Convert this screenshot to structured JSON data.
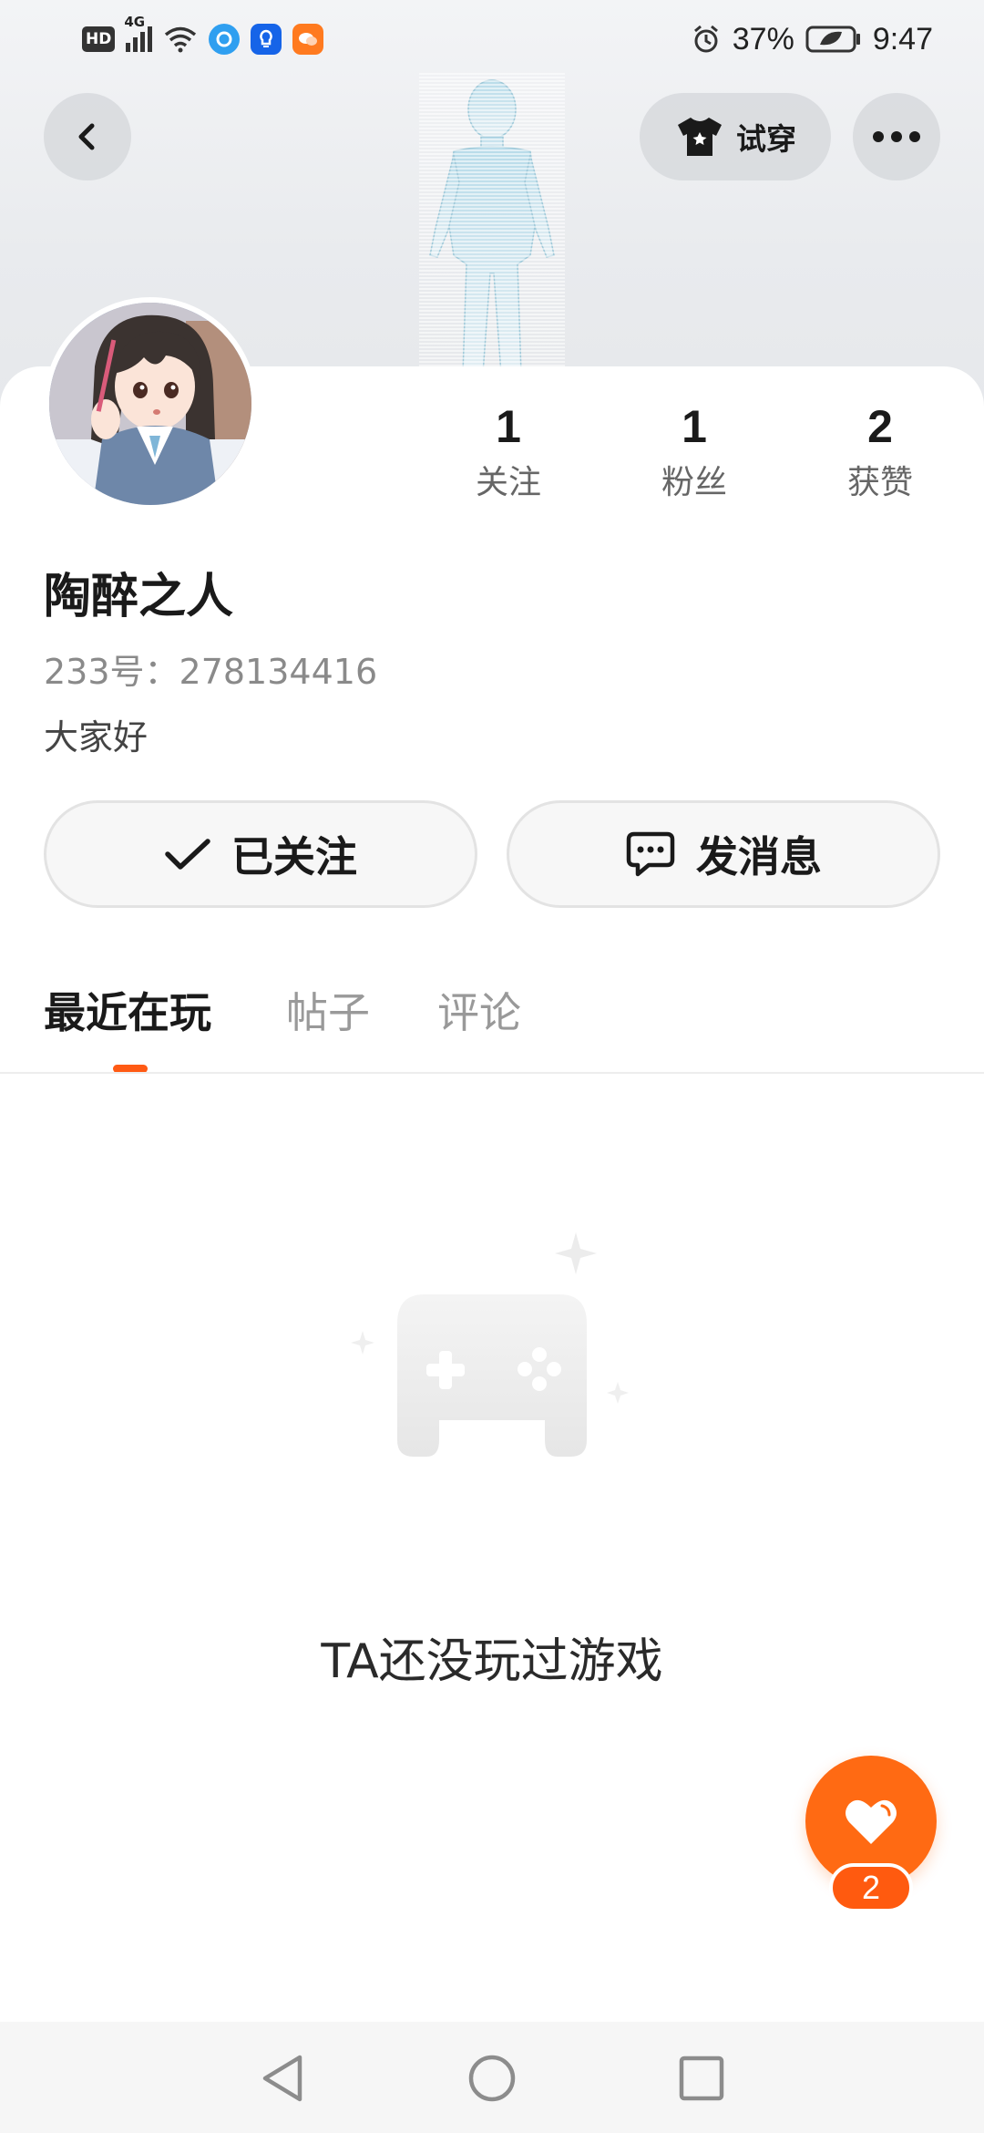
{
  "status_bar": {
    "hd_badge": "HD",
    "network": "4G",
    "battery_percent": "37%",
    "time": "9:47",
    "icons": [
      "hd-icon",
      "signal-icon",
      "wifi-icon",
      "app-icon-1",
      "app-icon-2",
      "app-icon-3",
      "alarm-icon",
      "battery-icon"
    ]
  },
  "header": {
    "try_on_label": "试穿",
    "icons": [
      "back-icon",
      "tshirt-icon",
      "more-icon"
    ]
  },
  "profile": {
    "username": "陶醉之人",
    "user_id": "233号：278134416",
    "bio": "大家好",
    "stats": [
      {
        "value": "1",
        "label": "关注"
      },
      {
        "value": "1",
        "label": "粉丝"
      },
      {
        "value": "2",
        "label": "获赞"
      }
    ]
  },
  "actions": {
    "follow_label": "已关注",
    "message_label": "发消息"
  },
  "tabs": [
    {
      "label": "最近在玩",
      "active": true
    },
    {
      "label": "帖子",
      "active": false
    },
    {
      "label": "评论",
      "active": false
    }
  ],
  "empty_state": {
    "text": "TA还没玩过游戏",
    "icon": "gamepad-icon"
  },
  "like_fab": {
    "count": "2",
    "icon": "heart-icon"
  },
  "colors": {
    "accent": "#ff6a13",
    "tab_indicator": "#ff5a14",
    "text_primary": "#1a1a1a",
    "text_secondary": "#8a8a8a"
  }
}
